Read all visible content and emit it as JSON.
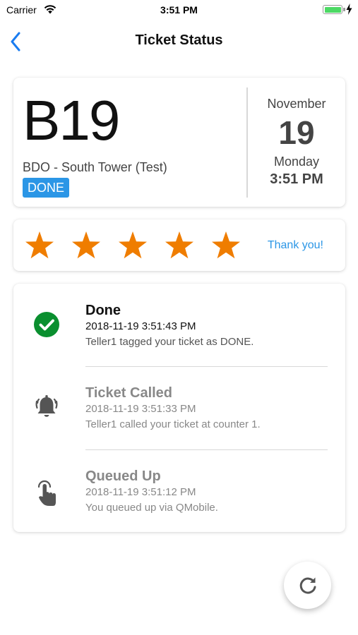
{
  "status_bar": {
    "carrier": "Carrier",
    "time": "3:51 PM",
    "battery_color": "#4cd964"
  },
  "nav": {
    "back_icon": "chevron-left-icon",
    "title": "Ticket Status"
  },
  "ticket": {
    "number": "B19",
    "branch": "BDO - South Tower (Test)",
    "status": "DONE",
    "status_color": "#2b96e6",
    "date": {
      "month": "November",
      "day": "19",
      "weekday": "Monday",
      "time": "3:51 PM"
    }
  },
  "rating": {
    "stars_total": 5,
    "stars_filled": 5,
    "star_color": "#ef7d00",
    "thank_you": "Thank you!"
  },
  "timeline": [
    {
      "icon": "check-circle-icon",
      "title": "Done",
      "timestamp": "2018-11-19 3:51:43 PM",
      "description": "Teller1 tagged your ticket as DONE."
    },
    {
      "icon": "bell-icon",
      "title": "Ticket Called",
      "timestamp": "2018-11-19 3:51:33 PM",
      "description": "Teller1 called your ticket at counter 1."
    },
    {
      "icon": "tap-hand-icon",
      "title": "Queued Up",
      "timestamp": "2018-11-19 3:51:12 PM",
      "description": "You queued up via QMobile."
    }
  ],
  "fab": {
    "icon": "refresh-icon"
  }
}
